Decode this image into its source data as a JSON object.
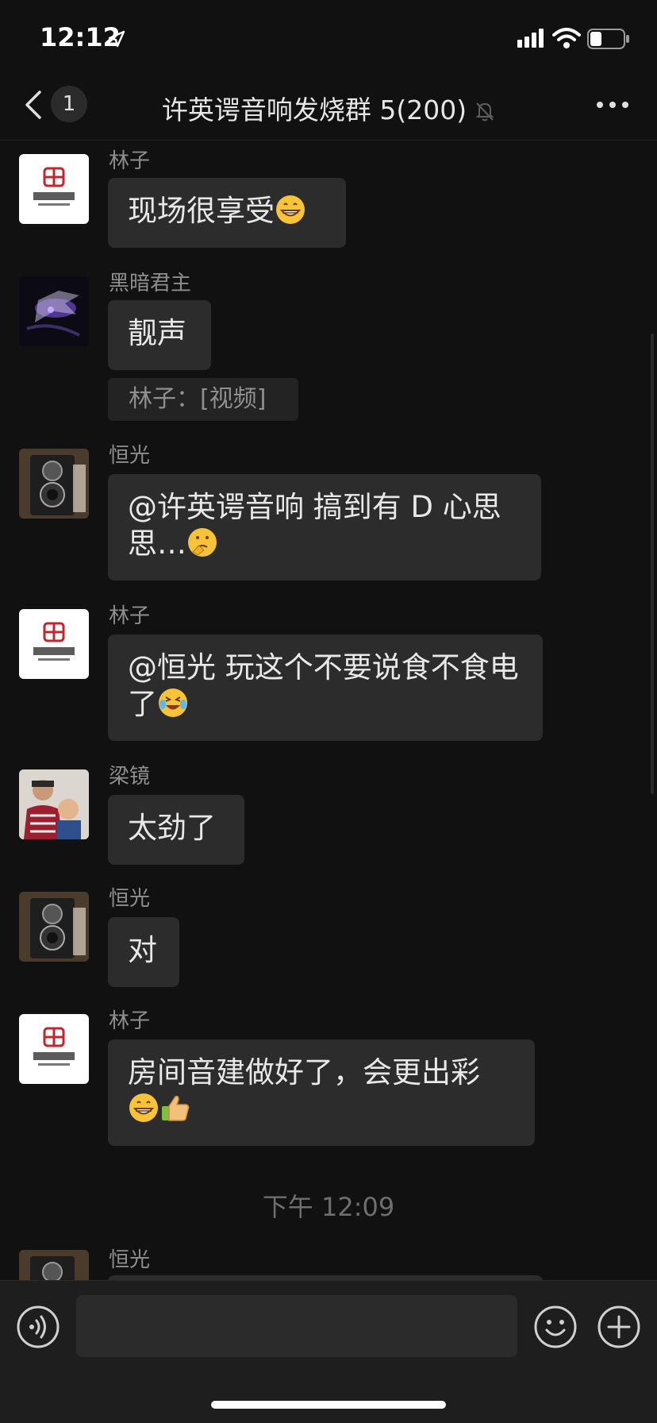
{
  "status_bar": {
    "time": "12:12",
    "battery_level": 0.35
  },
  "nav": {
    "unread_count": "1",
    "title": "许英谔音响发烧群 5(200)"
  },
  "messages": [
    {
      "sender": "林子",
      "text": "现场很享受",
      "emoji": [
        "grin"
      ]
    },
    {
      "sender": "黑暗君主",
      "text": "靓声",
      "quote": "林子：[视频]"
    },
    {
      "sender": "恒光",
      "text": "@许英谔音响 搞到有 D 心思思…",
      "emoji": [
        "thinking"
      ]
    },
    {
      "sender": "林子",
      "text": "@恒光 玩这个不要说食不食电了",
      "emoji": [
        "laugh-cry"
      ]
    },
    {
      "sender": "梁镜",
      "text": "太劲了"
    },
    {
      "sender": "恒光",
      "text": "对"
    },
    {
      "sender": "林子",
      "text": "房间音建做好了，会更出彩",
      "emoji": [
        "grin",
        "thumbs-up"
      ]
    },
    {
      "sender": "恒光",
      "text": ""
    }
  ],
  "timestamp": "下午 12:09",
  "input": {
    "value": "",
    "placeholder": ""
  },
  "avatar_logo_text": "丰图建筑",
  "colors": {
    "background": "#111111",
    "bubble": "#2c2c2c",
    "input_bar": "#1e1e1e"
  }
}
